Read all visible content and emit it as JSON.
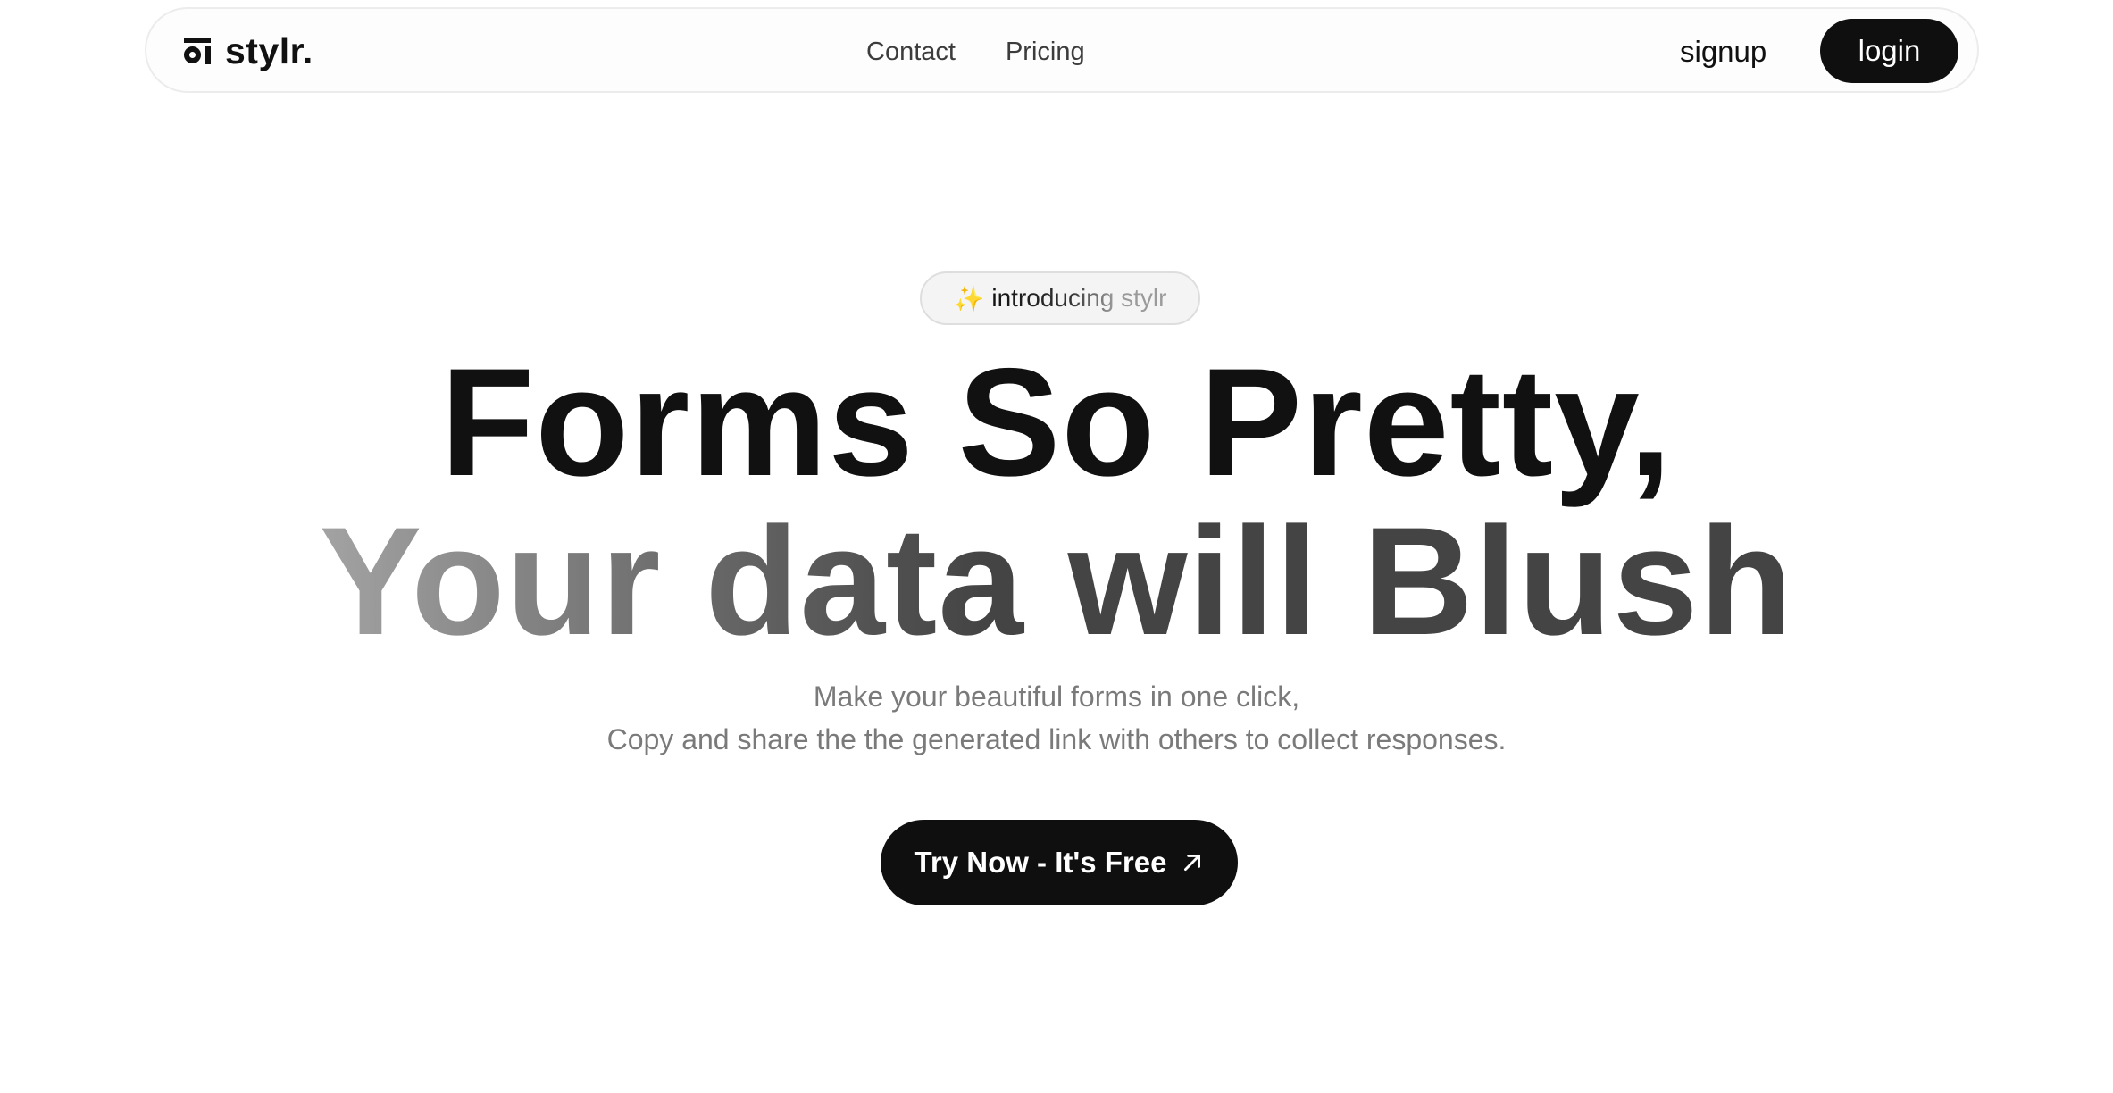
{
  "navbar": {
    "brand_name": "stylr.",
    "brand_icon": "stylr-logo-icon",
    "links": [
      {
        "label": "Contact"
      },
      {
        "label": "Pricing"
      }
    ],
    "signup_label": "signup",
    "login_label": "login"
  },
  "hero": {
    "pill_icon": "sparkles-icon",
    "pill_text": "introducing stylr",
    "headline_line1": "Forms So Pretty,",
    "headline_line2": "Your data will Blush",
    "subtitle_line1": "Make your beautiful forms in one click,",
    "subtitle_line2": "Copy and share the the generated link with others to collect responses.",
    "cta_label": "Try Now - It's Free",
    "cta_icon": "arrow-up-right-icon"
  },
  "colors": {
    "background": "#ffffff",
    "primary_dark": "#0f0f0f",
    "text_muted": "#7a7a7a",
    "headline_gray": "#444444",
    "sparkle": "#c9b690"
  }
}
